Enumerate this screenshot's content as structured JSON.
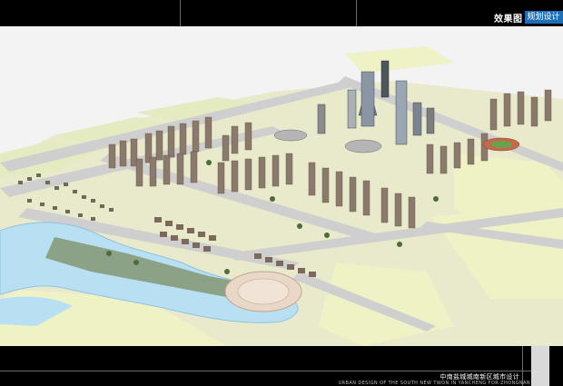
{
  "header": {
    "title": "效果图",
    "subtitle": "规划设计"
  },
  "footer": {
    "project_title_cn": "中南盐城城南新区城市设计",
    "project_title_en": "URBAN DESIGN OF THE SOUTH NEW TWON IN YANCHENG FOR ZHONGNAN"
  },
  "colors": {
    "frame": "#000000",
    "accent": "#1f6fb8",
    "road": "#c9c9c9",
    "land": "#eef0c9",
    "water": "#b7dff2",
    "building": "#7a6e62"
  }
}
